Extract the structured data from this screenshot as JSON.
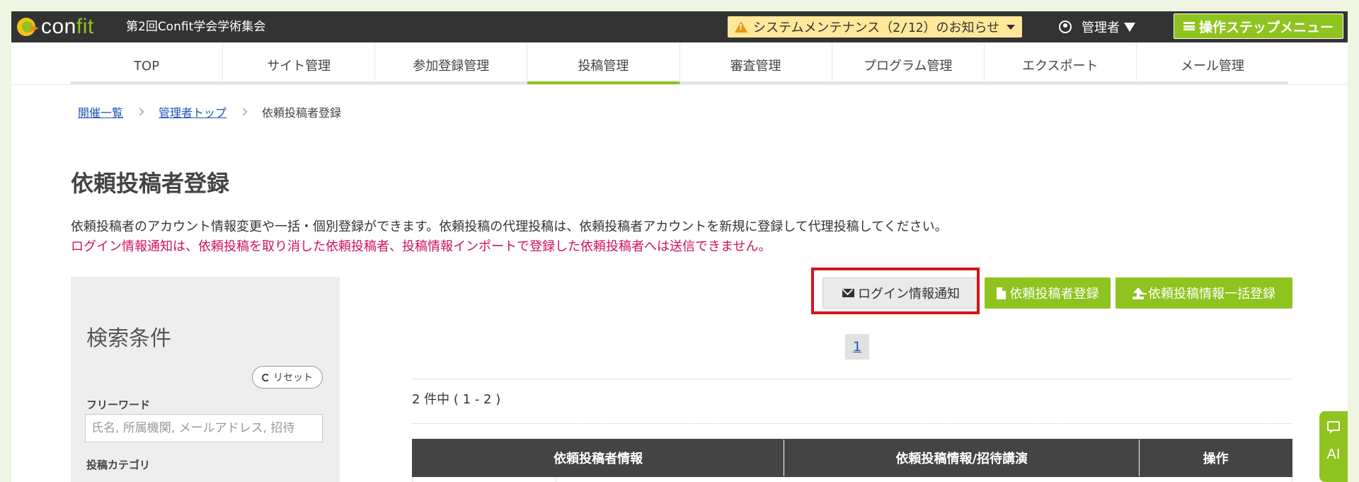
{
  "header": {
    "logo_text_prefix": "con",
    "logo_text_suffix": "fit",
    "event_title": "第2回Confit学会学術集会",
    "notice": "システムメンテナンス（2/12）のお知らせ",
    "admin_label": "管理者",
    "step_menu_label": "操作ステップメニュー"
  },
  "nav": {
    "tabs": [
      "TOP",
      "サイト管理",
      "参加登録管理",
      "投稿管理",
      "審査管理",
      "プログラム管理",
      "エクスポート",
      "メール管理"
    ],
    "active": "投稿管理"
  },
  "breadcrumb": {
    "items": [
      "開催一覧",
      "管理者トップ"
    ],
    "current": "依頼投稿者登録"
  },
  "page": {
    "title": "依頼投稿者登録",
    "description": "依頼投稿者のアカウント情報変更や一括・個別登録ができます。依頼投稿の代理投稿は、依頼投稿者アカウントを新規に登録して代理投稿してください。",
    "warning": "ログイン情報通知は、依頼投稿を取り消した依頼投稿者、投稿情報インポートで登録した依頼投稿者へは送信できません。"
  },
  "sidebar": {
    "title": "検索条件",
    "reset_label": "リセット",
    "freeword_label": "フリーワード",
    "freeword_placeholder": "氏名, 所属機関, メールアドレス, 招待",
    "category_label": "投稿カテゴリ"
  },
  "actions": {
    "login_notify": "ログイン情報通知",
    "register": "依頼投稿者登録",
    "bulk_register": "依頼投稿情報一括登録"
  },
  "pagination": {
    "current_page": "1"
  },
  "results": {
    "summary": "2 件中 ( 1 - 2 )"
  },
  "table": {
    "headers": [
      "依頼投稿者情報",
      "依頼投稿情報/招待講演",
      "操作"
    ]
  },
  "ai_tab": {
    "label": "AI"
  },
  "colors": {
    "accent_green": "#8fc31f",
    "topbar": "#333333",
    "warning_text": "#d0115c",
    "highlight_box": "#d6141b",
    "link": "#1a57b0"
  },
  "icons": [
    "warning-icon",
    "user-icon",
    "menu-icon",
    "mail-icon",
    "document-icon",
    "upload-icon",
    "refresh-icon",
    "chat-icon"
  ]
}
